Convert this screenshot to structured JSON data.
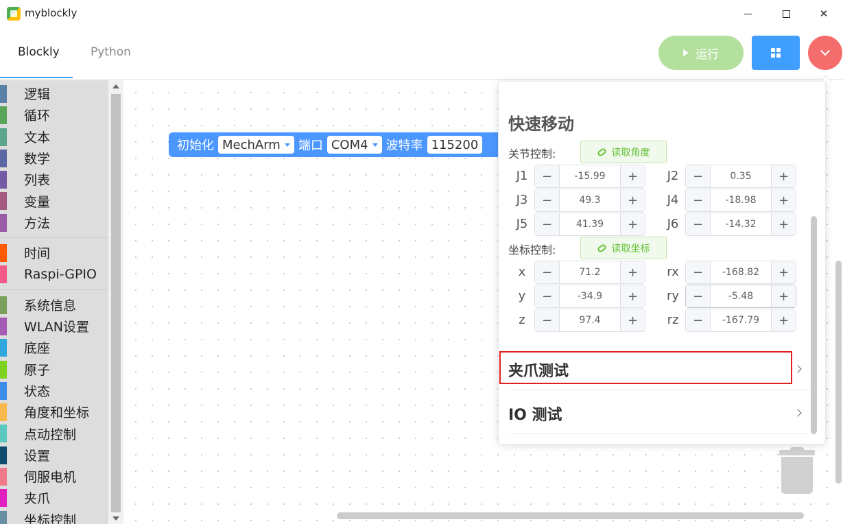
{
  "window": {
    "title": "myblockly",
    "minimize_icon": "minimize-icon",
    "maximize_icon": "maximize-icon",
    "close_label": "✕"
  },
  "tabs": [
    {
      "label": "Blockly",
      "active": true
    },
    {
      "label": "Python",
      "active": false
    }
  ],
  "toolbar": {
    "run_label": "运行",
    "run_color": "#b3e19d",
    "grid_color": "#409eff",
    "dropdown_color": "#f56c6c"
  },
  "toolbox": {
    "groups": [
      [
        {
          "label": "逻辑",
          "color": "#5b80a5"
        },
        {
          "label": "循环",
          "color": "#5ba55b"
        },
        {
          "label": "文本",
          "color": "#5ba58c"
        },
        {
          "label": "数学",
          "color": "#5b67a5"
        },
        {
          "label": "列表",
          "color": "#745ba5"
        },
        {
          "label": "变量",
          "color": "#a55b80"
        },
        {
          "label": "方法",
          "color": "#995ba5"
        }
      ],
      [
        {
          "label": "时间",
          "color": "#ff5a00"
        },
        {
          "label": "Raspi-GPIO",
          "color": "#f25a8a"
        }
      ],
      [
        {
          "label": "系统信息",
          "color": "#7ba05b"
        },
        {
          "label": "WLAN设置",
          "color": "#a55bb5"
        },
        {
          "label": "底座",
          "color": "#2fa8e0"
        },
        {
          "label": "原子",
          "color": "#7ed321"
        },
        {
          "label": "状态",
          "color": "#3b8ee8"
        },
        {
          "label": "角度和坐标",
          "color": "#f8b84e"
        },
        {
          "label": "点动控制",
          "color": "#5cc9c0"
        },
        {
          "label": "设置",
          "color": "#0f4c6e"
        },
        {
          "label": "伺服电机",
          "color": "#f07a8a"
        },
        {
          "label": "夹爪",
          "color": "#e020c0"
        },
        {
          "label": "坐标控制",
          "color": "#6a8fa5"
        }
      ]
    ]
  },
  "block": {
    "init_label": "初始化",
    "model_value": "MechArm",
    "port_label": "端口",
    "port_value": "COM4",
    "baud_label": "波特率",
    "baud_value": "115200",
    "color": "#4c97ff"
  },
  "panel": {
    "title": "快速移动",
    "joint_section_label": "关节控制:",
    "read_angles_label": "读取角度",
    "coord_section_label": "坐标控制:",
    "read_coords_label": "读取坐标",
    "minus": "−",
    "plus": "+",
    "joints": [
      {
        "label": "J1",
        "value": "-15.99"
      },
      {
        "label": "J2",
        "value": "0.35"
      },
      {
        "label": "J3",
        "value": "49.3"
      },
      {
        "label": "J4",
        "value": "-18.98"
      },
      {
        "label": "J5",
        "value": "41.39"
      },
      {
        "label": "J6",
        "value": "-14.32"
      }
    ],
    "coords": [
      {
        "label": "x",
        "value": "71.2"
      },
      {
        "label": "rx",
        "value": "-168.82"
      },
      {
        "label": "y",
        "value": "-34.9"
      },
      {
        "label": "ry",
        "value": "-5.48"
      },
      {
        "label": "z",
        "value": "97.4"
      },
      {
        "label": "rz",
        "value": "-167.79"
      }
    ],
    "gripper_test_label": "夹爪测试",
    "io_test_label": "IO 测试",
    "highlight_color": "#e02020"
  }
}
